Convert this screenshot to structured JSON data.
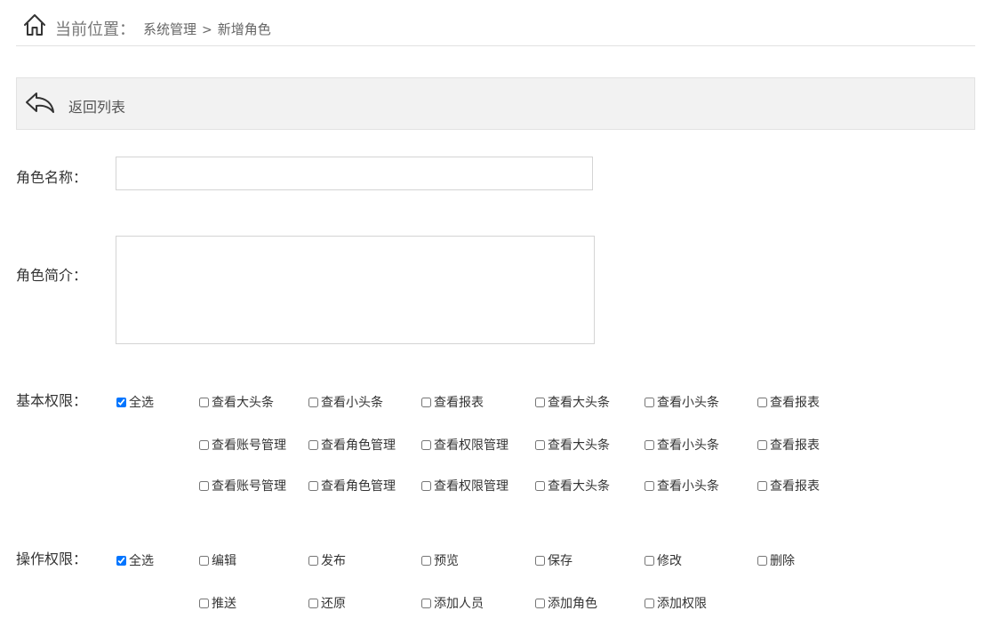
{
  "breadcrumb": {
    "label": "当前位置：",
    "items": [
      "系统管理",
      "新增角色"
    ],
    "separator": ">"
  },
  "toolbar": {
    "back_label": "返回列表"
  },
  "form": {
    "role_name_label": "角色名称：",
    "role_name_value": "",
    "role_desc_label": "角色简介：",
    "role_desc_value": "",
    "basic_perm_label": "基本权限：",
    "op_perm_label": "操作权限："
  },
  "basic_permissions": {
    "select_all": {
      "label": "全选",
      "checked": true
    },
    "rows": [
      [
        "查看大头条",
        "查看小头条",
        "查看报表",
        "查看大头条",
        "查看小头条",
        "查看报表"
      ],
      [
        "查看账号管理",
        "查看角色管理",
        "查看权限管理",
        "查看大头条",
        "查看小头条",
        "查看报表"
      ],
      [
        "查看账号管理",
        "查看角色管理",
        "查看权限管理",
        "查看大头条",
        "查看小头条",
        "查看报表"
      ]
    ]
  },
  "operation_permissions": {
    "select_all": {
      "label": "全选",
      "checked": true
    },
    "rows": [
      [
        "编辑",
        "发布",
        "预览",
        "保存",
        "修改",
        "删除"
      ],
      [
        "推送",
        "还原",
        "添加人员",
        "添加角色",
        "添加权限"
      ]
    ]
  },
  "icons": {
    "home": "home-icon",
    "back": "back-arrow-icon"
  },
  "colors": {
    "toolbar_bg": "#f2f2f2",
    "border": "#d4d4d4",
    "text": "#333333"
  }
}
